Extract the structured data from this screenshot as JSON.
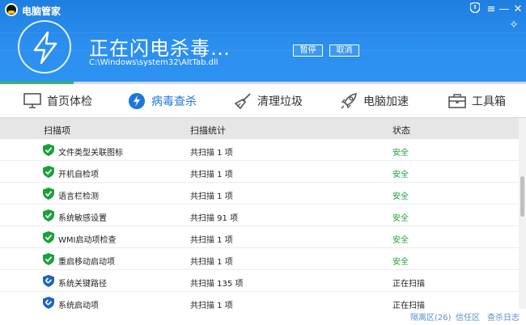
{
  "app": {
    "title": "电脑管家"
  },
  "colors": {
    "brand": "#2b8ff0",
    "progress": "#3bb55c",
    "safe": "#1aa13a",
    "active_tab": "#1c78d7"
  },
  "header": {
    "title": "正在闪电杀毒…",
    "path": "C:\\Windows\\system32\\AltTab.dll",
    "pause_label": "暂停",
    "cancel_label": "取消",
    "progress_percent": 14
  },
  "nav": {
    "items": [
      {
        "label": "首页体检",
        "icon": "monitor-icon"
      },
      {
        "label": "病毒查杀",
        "icon": "bolt-icon",
        "active": true
      },
      {
        "label": "清理垃圾",
        "icon": "broom-icon"
      },
      {
        "label": "电脑加速",
        "icon": "rocket-icon"
      },
      {
        "label": "工具箱",
        "icon": "toolbox-icon"
      }
    ]
  },
  "table": {
    "headers": [
      "扫描项",
      "扫描统计",
      "状态"
    ],
    "rows": [
      {
        "name": "文件类型关联图标",
        "stat": "共扫描 1 项",
        "status": "安全",
        "state": "safe"
      },
      {
        "name": "开机自检项",
        "stat": "共扫描 1 项",
        "status": "安全",
        "state": "safe"
      },
      {
        "name": "语言栏检测",
        "stat": "共扫描 1 项",
        "status": "安全",
        "state": "safe"
      },
      {
        "name": "系统敏感设置",
        "stat": "共扫描 91 项",
        "status": "安全",
        "state": "safe"
      },
      {
        "name": "WMI启动项检查",
        "stat": "共扫描 1 项",
        "status": "安全",
        "state": "safe"
      },
      {
        "name": "重启移动启动项",
        "stat": "共扫描 1 项",
        "status": "安全",
        "state": "safe"
      },
      {
        "name": "系统关键路径",
        "stat": "共扫描 135 项",
        "status": "正在扫描",
        "state": "scanning"
      },
      {
        "name": "系统启动项",
        "stat": "共扫描 1 项",
        "status": "正在扫描",
        "state": "scanning"
      }
    ]
  },
  "footer": {
    "quarantine": "隔离区(26)",
    "trust": "信任区",
    "log": "查杀日志"
  }
}
